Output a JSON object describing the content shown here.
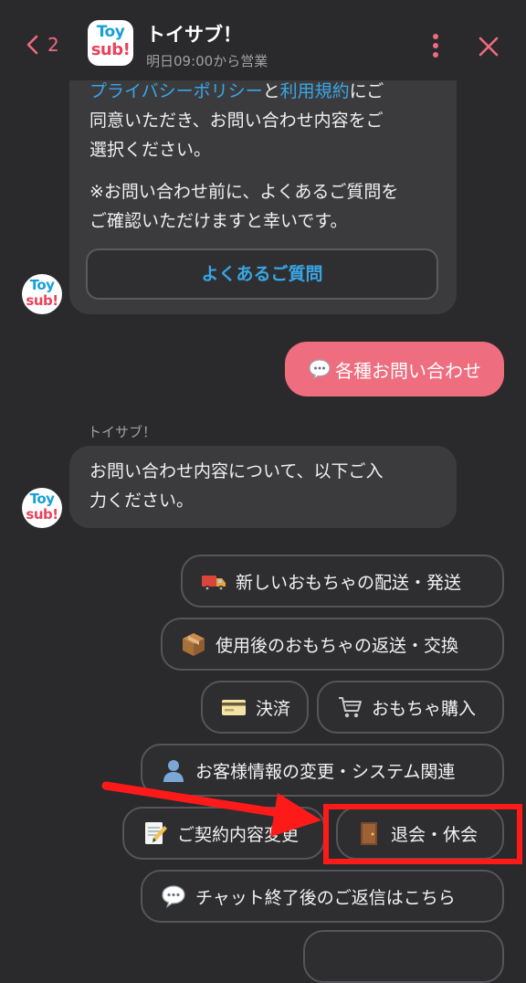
{
  "header": {
    "back_count": "2",
    "title": "トイサブ！",
    "status": "明日09:00から営業"
  },
  "logo": {
    "line1": "Toy",
    "line2": "sub!"
  },
  "messages": {
    "intro": {
      "link_privacy": "プライバシーポリシー",
      "connector": "と",
      "link_terms": "利用規約",
      "line1_tail": "にご",
      "line2": "同意いただき、お問い合わせ内容をご",
      "line3": "選択ください。",
      "line4": "※お問い合わせ前に、よくあるご質問を",
      "line5": "ご確認いただけますと幸いです。",
      "faq_button": "よくあるご質問"
    },
    "user_choice": "各種お問い合わせ",
    "bot_name": "トイサブ！",
    "prompt_line1": "お問い合わせ内容について、以下ご入",
    "prompt_line2": "力ください。"
  },
  "choices": [
    {
      "icon": "delivery-truck-icon",
      "label": "新しいおもちゃの配送・発送"
    },
    {
      "icon": "package-icon",
      "label": "使用後のおもちゃの返送・交換"
    },
    {
      "icon": "credit-card-icon",
      "label": "決済"
    },
    {
      "icon": "shopping-cart-icon",
      "label": "おもちゃ購入"
    },
    {
      "icon": "user-icon",
      "label": "お客様情報の変更・システム関連"
    },
    {
      "icon": "memo-icon",
      "label": "ご契約内容変更"
    },
    {
      "icon": "door-icon",
      "label": "退会・休会"
    },
    {
      "icon": "speech-bubble-icon",
      "label": "チャット終了後のご返信はこちら"
    }
  ],
  "colors": {
    "background": "#2a2a2c",
    "bubble": "#3b3b3e",
    "accent_pink": "#ee6d7e",
    "link_blue": "#38a6e6",
    "annotation_red": "#ff1a1a"
  }
}
